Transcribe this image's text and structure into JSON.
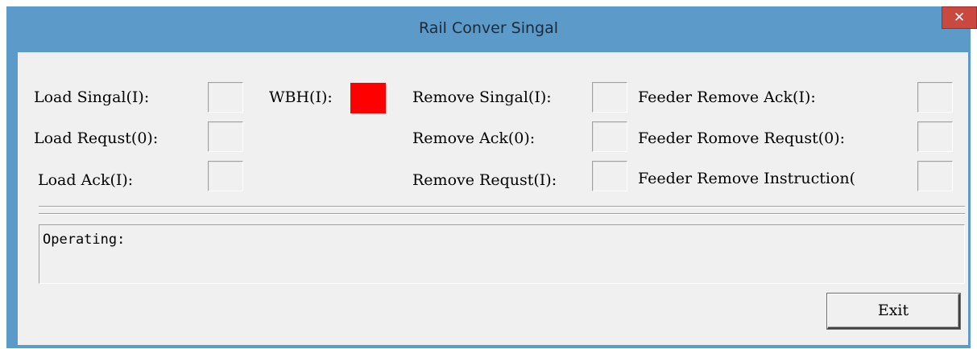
{
  "window": {
    "title": "Rail Conver Singal",
    "close_glyph": "✕",
    "title_bar_color": "#5b9ac9",
    "close_color": "#c9483f"
  },
  "signals": {
    "load_singal": "Load Singal(I):",
    "load_requst": "Load Requst(0):",
    "load_ack": "Load Ack(I):",
    "wbh": "WBH(I):",
    "wbh_color": "#ff0000",
    "remove_singal": "Remove Singal(I):",
    "remove_ack": "Remove Ack(0):",
    "remove_requst": "Remove Requst(I):",
    "feeder_remove_ack": "Feeder Remove Ack(I):",
    "feeder_romove_requst": "Feeder Romove Requst(0):",
    "feeder_remove_instruction": "Feeder Remove Instruction("
  },
  "status": {
    "operating_label": "Operating:"
  },
  "buttons": {
    "exit": "Exit"
  }
}
